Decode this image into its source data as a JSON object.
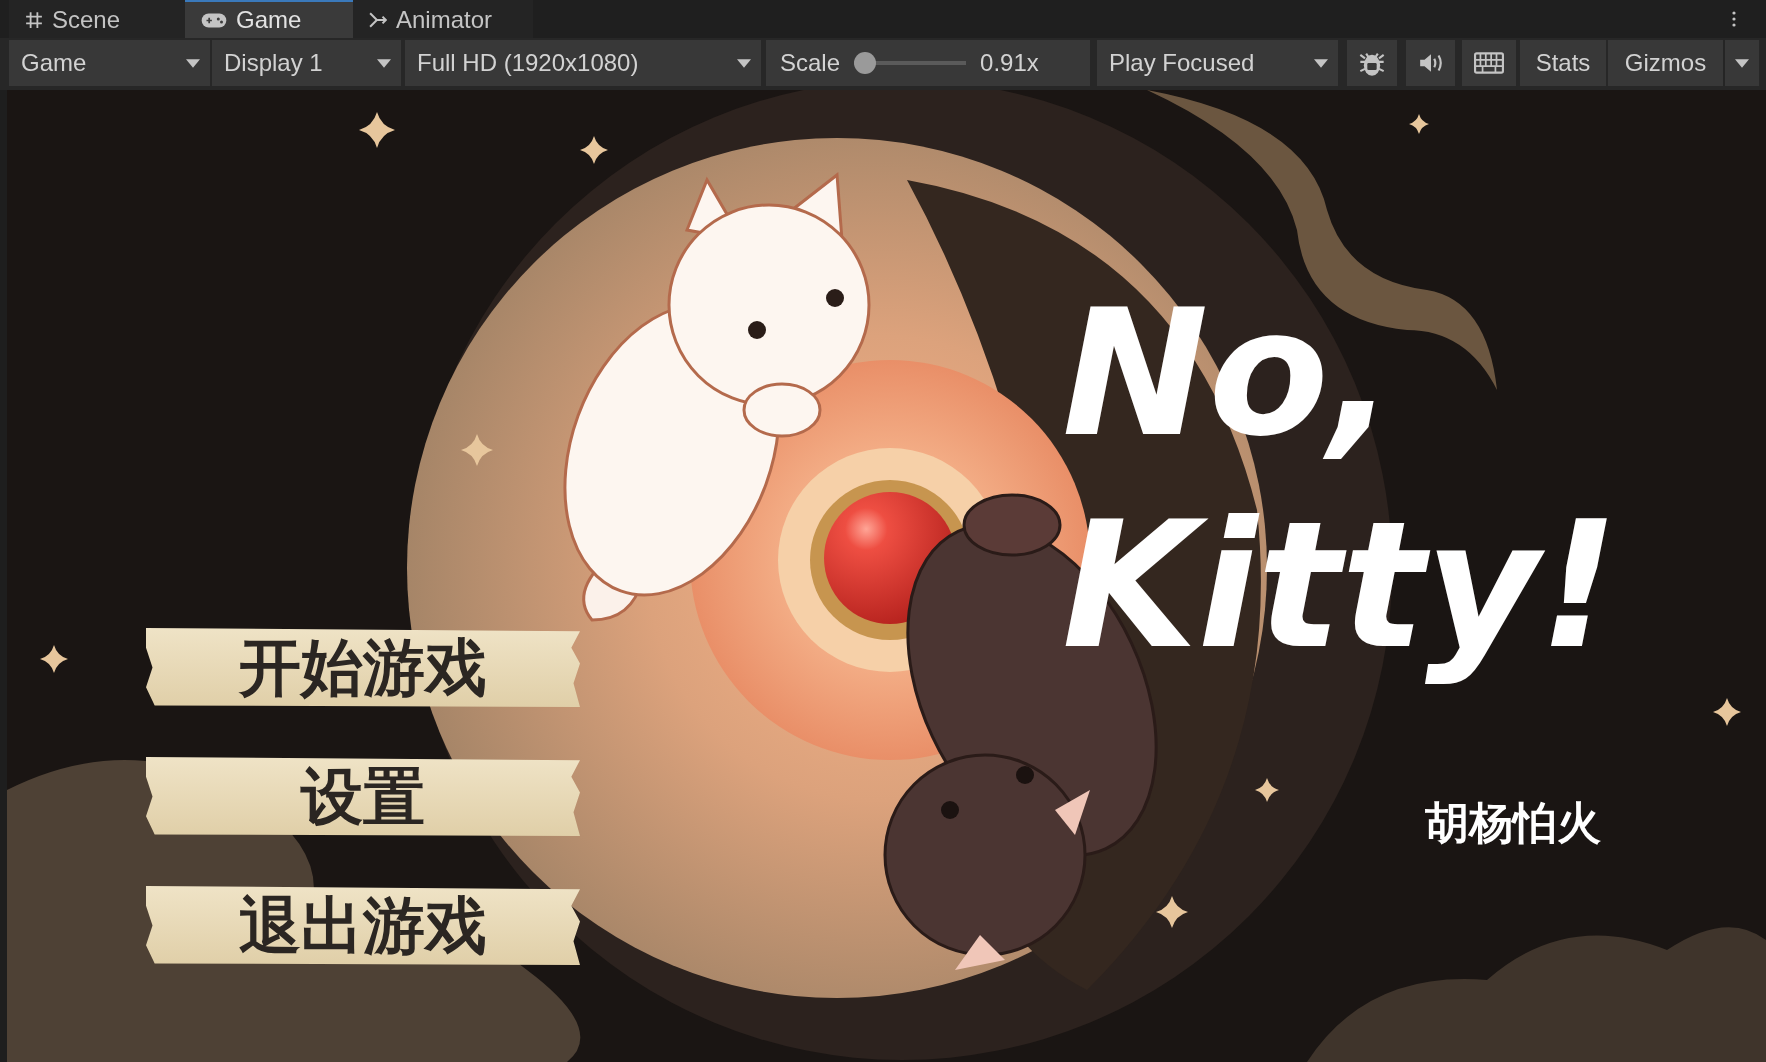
{
  "tabs": [
    {
      "label": "Scene",
      "selected": false
    },
    {
      "label": "Game",
      "selected": true
    },
    {
      "label": "Animator",
      "selected": false
    }
  ],
  "toolbar": {
    "view": "Game",
    "display": "Display 1",
    "resolution": "Full HD (1920x1080)",
    "scale": {
      "label": "Scale",
      "level": 0,
      "reading": "0.91x"
    },
    "play_mode": "Play Focused",
    "stats": "Stats",
    "gizmos": "Gizmos"
  },
  "game": {
    "title": "No, Kitty!",
    "menu": [
      "开始游戏",
      "设置",
      "退出游戏"
    ],
    "author": "胡杨怕火"
  }
}
